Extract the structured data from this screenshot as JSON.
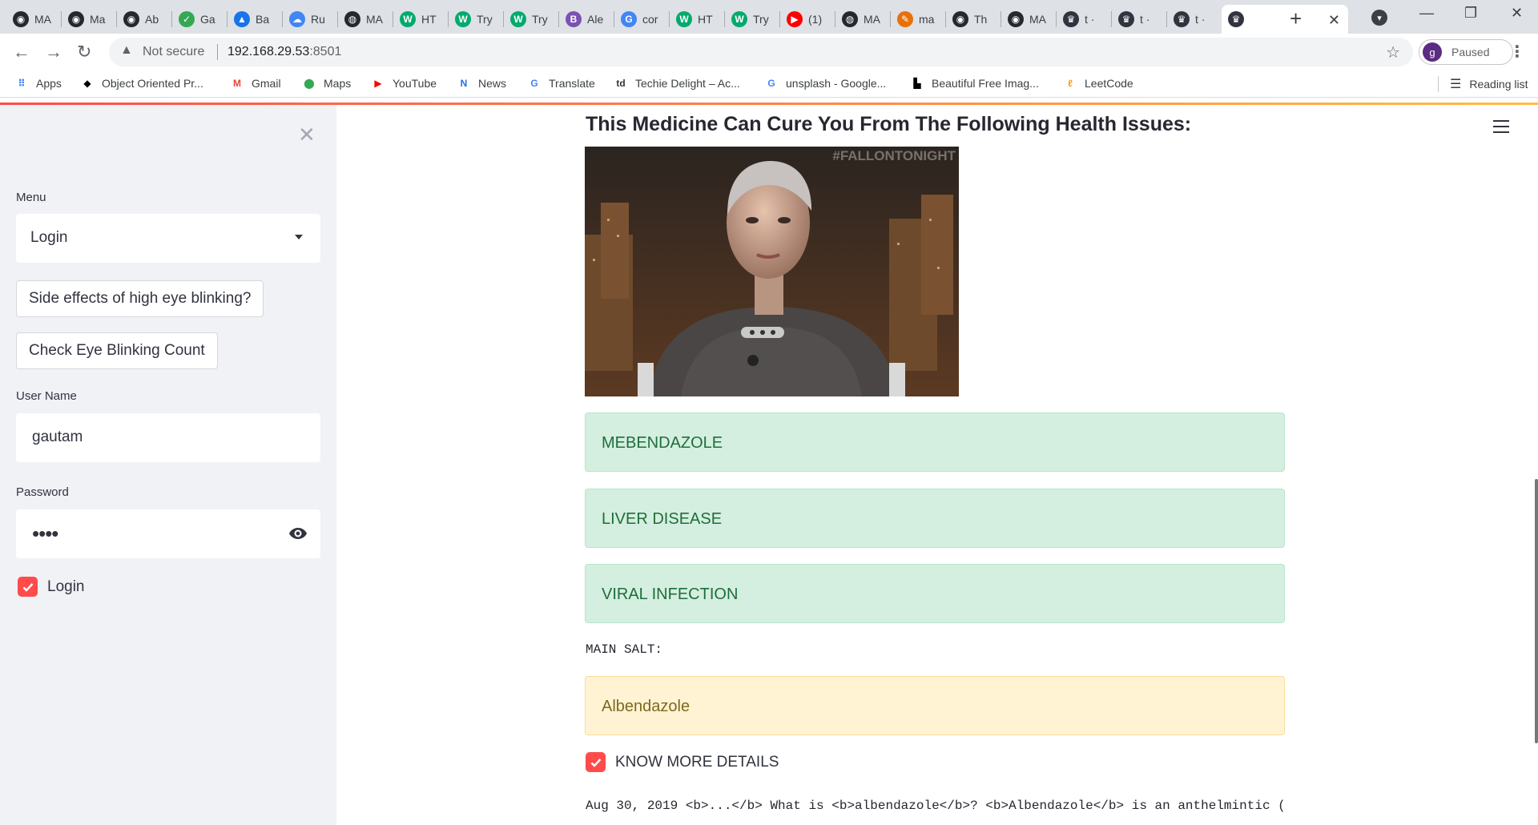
{
  "browser": {
    "tabs": [
      {
        "title": "MA",
        "icon": "github-icon",
        "color": "#24292e"
      },
      {
        "title": "Ma",
        "icon": "github-icon",
        "color": "#24292e"
      },
      {
        "title": "Ab",
        "icon": "github-icon",
        "color": "#24292e"
      },
      {
        "title": "Ga",
        "icon": "leaf-icon",
        "color": "#34a853"
      },
      {
        "title": "Ba",
        "icon": "triangle-icon",
        "color": "#1a73e8"
      },
      {
        "title": "Ru",
        "icon": "cloud-icon",
        "color": "#4285f4"
      },
      {
        "title": "MA",
        "icon": "globe-icon",
        "color": "#24292e"
      },
      {
        "title": "HT",
        "icon": "w-icon",
        "color": "#04aa6d"
      },
      {
        "title": "Try",
        "icon": "w-icon",
        "color": "#04aa6d"
      },
      {
        "title": "Try",
        "icon": "w-icon",
        "color": "#04aa6d"
      },
      {
        "title": "Ale",
        "icon": "b-icon",
        "color": "#7952b3"
      },
      {
        "title": "cor",
        "icon": "google-icon",
        "color": "#4285f4"
      },
      {
        "title": "HT",
        "icon": "w-icon",
        "color": "#04aa6d"
      },
      {
        "title": "Try",
        "icon": "w-icon",
        "color": "#04aa6d"
      },
      {
        "title": "(1)",
        "icon": "youtube-icon",
        "color": "#ff0000"
      },
      {
        "title": "MA",
        "icon": "globe-icon",
        "color": "#24292e"
      },
      {
        "title": "ma",
        "icon": "feather-icon",
        "color": "#e8710a"
      },
      {
        "title": "Th",
        "icon": "github-icon",
        "color": "#24292e"
      },
      {
        "title": "MA",
        "icon": "github-icon",
        "color": "#24292e"
      },
      {
        "title": "t ·",
        "icon": "streamlit-icon",
        "color": "#31333f"
      },
      {
        "title": "t ·",
        "icon": "streamlit-icon",
        "color": "#31333f"
      },
      {
        "title": "t ·",
        "icon": "streamlit-icon",
        "color": "#31333f"
      }
    ],
    "active_tab_icon": "streamlit-icon",
    "new_tab": "+",
    "not_secure": "Not secure",
    "url_host": "192.168.29.53",
    "url_port": ":8501",
    "profile_initial": "g",
    "profile_status": "Paused",
    "bookmarks": [
      {
        "label": "Apps",
        "icon": "apps-grid-icon",
        "color": "#4285f4"
      },
      {
        "label": "Object Oriented Pr...",
        "icon": "object-oriented-icon",
        "color": "#000000"
      },
      {
        "label": "Gmail",
        "icon": "gmail-icon",
        "color": "#ea4335"
      },
      {
        "label": "Maps",
        "icon": "maps-pin-icon",
        "color": "#34a853"
      },
      {
        "label": "YouTube",
        "icon": "youtube-icon",
        "color": "#ff0000"
      },
      {
        "label": "News",
        "icon": "news-icon",
        "color": "#1a73e8"
      },
      {
        "label": "Translate",
        "icon": "translate-icon",
        "color": "#4285f4"
      },
      {
        "label": "Techie Delight – Ac...",
        "icon": "td-icon",
        "color": "#333333"
      },
      {
        "label": "unsplash - Google...",
        "icon": "google-icon",
        "color": "#4285f4"
      },
      {
        "label": "Beautiful Free Imag...",
        "icon": "unsplash-icon",
        "color": "#000000"
      },
      {
        "label": "LeetCode",
        "icon": "leetcode-icon",
        "color": "#ffa116"
      }
    ],
    "reading_list": "Reading list"
  },
  "sidebar": {
    "menu_label": "Menu",
    "menu_value": "Login",
    "button_side_effects": "Side effects of high eye blinking?",
    "button_check_count": "Check Eye Blinking Count",
    "username_label": "User Name",
    "username_value": "gautam",
    "password_label": "Password",
    "password_masked": "••••",
    "login_checkbox_label": "Login",
    "login_checked": true
  },
  "main": {
    "heading": "This Medicine Can Cure You From The Following Health Issues:",
    "gif_watermark": "#FALLONTONIGHT",
    "health_issues": [
      "MEBENDAZOLE",
      "LIVER DISEASE",
      "VIRAL INFECTION"
    ],
    "main_salt_label": "MAIN SALT:",
    "main_salt_value": "Albendazole",
    "know_more_label": "KNOW MORE DETAILS",
    "know_more_checked": true,
    "details_text": "Aug 30, 2019 <b>...</b> What is <b>albendazole</b>? <b>Albendazole</b> is an anthelmintic ("
  },
  "colors": {
    "accent": "#ff4b4b",
    "success_bg": "#d4efdf",
    "success_text": "#1f6d3c",
    "warning_bg": "#fff3d4",
    "warning_text": "#7d6a1c",
    "sidebar_bg": "#f0f2f6"
  }
}
